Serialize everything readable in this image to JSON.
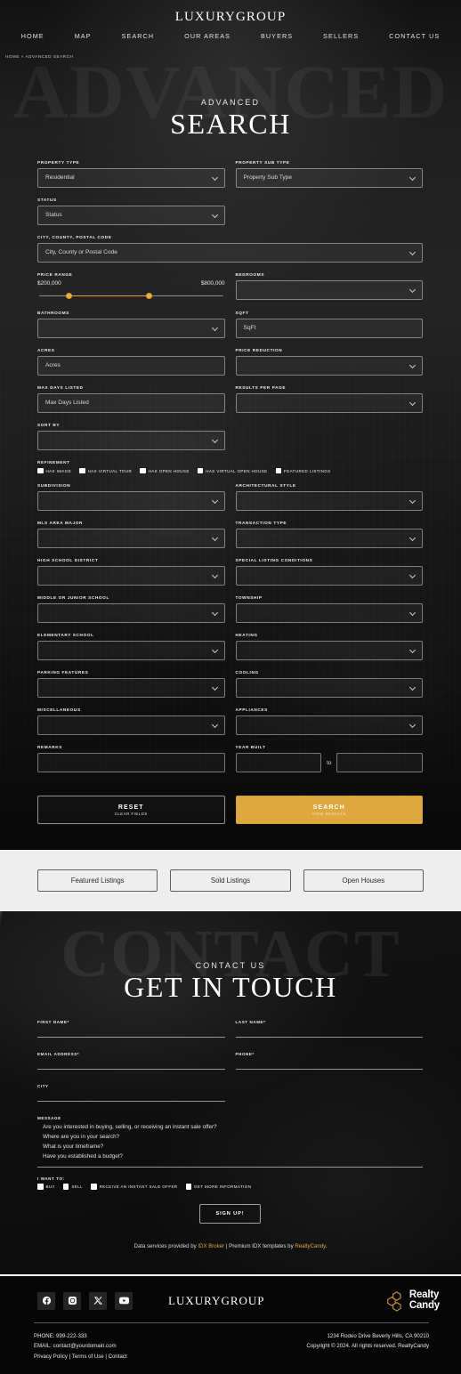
{
  "header": {
    "brand": "LUXURYGROUP",
    "nav": [
      {
        "label": "HOME"
      },
      {
        "label": "MAP"
      },
      {
        "label": "SEARCH"
      },
      {
        "label": "OUR AREAS"
      },
      {
        "label": "BUYERS"
      },
      {
        "label": "SELLERS"
      },
      {
        "label": "CONTACT US"
      }
    ],
    "breadcrumb": "HOME » ADVANCED SEARCH"
  },
  "hero": {
    "ghost_word": "ADVANCED",
    "eyebrow": "ADVANCED",
    "title": "SEARCH"
  },
  "search_form": {
    "property_type": {
      "label": "PROPERTY TYPE",
      "value": "Residential"
    },
    "property_sub_type": {
      "label": "PROPERTY SUB TYPE",
      "value": "Property Sub Type"
    },
    "status": {
      "label": "STATUS",
      "value": "Status"
    },
    "city_county_postal": {
      "label": "CITY, COUNTY, POSTAL CODE",
      "value": "City, County or Postal Code"
    },
    "price_range": {
      "label": "PRICE RANGE",
      "min": "$200,000",
      "max": "$800,000",
      "accent": "#e2a13a"
    },
    "bedrooms": {
      "label": "BEDROOMS",
      "value": ""
    },
    "bathrooms": {
      "label": "BATHROOMS",
      "value": ""
    },
    "sqft": {
      "label": "SQFT",
      "value": "SqFt"
    },
    "acres": {
      "label": "ACRES",
      "value": "Acres"
    },
    "price_reduction": {
      "label": "PRICE REDUCTION",
      "value": ""
    },
    "max_days_listed": {
      "label": "MAX DAYS LISTED",
      "value": "Max Days Listed"
    },
    "results_per_page": {
      "label": "RESULTS PER PAGE",
      "value": ""
    },
    "sort_by": {
      "label": "SORT BY",
      "value": ""
    },
    "refinement": {
      "label": "REFINEMENT",
      "options": [
        {
          "label": "HAS IMAGE",
          "checked": false
        },
        {
          "label": "HAS VIRTUAL TOUR",
          "checked": false
        },
        {
          "label": "HAS OPEN HOUSE",
          "checked": false
        },
        {
          "label": "HAS VIRTUAL OPEN HOUSE",
          "checked": false
        },
        {
          "label": "FEATURED LISTINGS",
          "checked": false
        }
      ]
    },
    "subdivision": {
      "label": "SUBDIVISION",
      "value": ""
    },
    "architectural_style": {
      "label": "ARCHITECTURAL STYLE",
      "value": ""
    },
    "mls_area_major": {
      "label": "MLS AREA MAJOR",
      "value": ""
    },
    "transaction_type": {
      "label": "TRANSACTION TYPE",
      "value": ""
    },
    "high_school_district": {
      "label": "HIGH SCHOOL DISTRICT",
      "value": ""
    },
    "special_listing_conditions": {
      "label": "SPECIAL LISTING CONDITIONS",
      "value": ""
    },
    "middle_or_junior_school": {
      "label": "MIDDLE OR JUNIOR SCHOOL",
      "value": ""
    },
    "township": {
      "label": "TOWNSHIP",
      "value": ""
    },
    "elementary_school": {
      "label": "ELEMENTARY SCHOOL",
      "value": ""
    },
    "heating": {
      "label": "HEATING",
      "value": ""
    },
    "parking_features": {
      "label": "PARKING FEATURES",
      "value": ""
    },
    "cooling": {
      "label": "COOLING",
      "value": ""
    },
    "miscellaneous": {
      "label": "MISCELLANEOUS",
      "value": ""
    },
    "appliances": {
      "label": "APPLIANCES",
      "value": ""
    },
    "remarks": {
      "label": "REMARKS",
      "value": ""
    },
    "year_built": {
      "label": "YEAR BUILT",
      "from": "",
      "separator": "to",
      "to": ""
    },
    "reset_button": {
      "title": "RESET",
      "subtitle": "CLEAR FIELDS"
    },
    "search_button": {
      "title": "SEARCH",
      "subtitle": "VIEW RESULTS",
      "color": "#dfa83e"
    }
  },
  "listing_links": [
    {
      "label": "Featured Listings"
    },
    {
      "label": "Sold Listings"
    },
    {
      "label": "Open Houses"
    }
  ],
  "contact": {
    "ghost_word": "CONTACT",
    "eyebrow": "CONTACT US",
    "title": "GET IN TOUCH",
    "fields": {
      "first_name": {
        "label": "FIRST NAME*",
        "value": ""
      },
      "last_name": {
        "label": "LAST NAME*",
        "value": ""
      },
      "email": {
        "label": "EMAIL ADDRESS*",
        "value": ""
      },
      "phone": {
        "label": "PHONE*",
        "value": ""
      },
      "city": {
        "label": "CITY",
        "value": ""
      },
      "message": {
        "label": "MESSAGE",
        "lines": [
          "Are you interested in buying, selling, or receiving an instant sale offer?",
          "Where are you in your search?",
          "What is your timeframe?",
          "Have you established a budget?"
        ]
      }
    },
    "i_want_to": {
      "label": "I WANT TO:",
      "options": [
        {
          "label": "BUY",
          "checked": false
        },
        {
          "label": "SELL",
          "checked": false
        },
        {
          "label": "RECEIVE AN INSTANT SALE OFFER",
          "checked": false
        },
        {
          "label": "GET MORE INFORMATION",
          "checked": false
        }
      ]
    },
    "signup_button": "SIGN UP!"
  },
  "data_services": {
    "prefix": "Data services provided by ",
    "idx_broker": "IDX Broker",
    "middle": " | Premium IDX templates by ",
    "realty_candy": "RealtyCandy",
    "suffix": ".",
    "link_color": "#dfa83e"
  },
  "footer": {
    "socials": [
      {
        "name": "facebook"
      },
      {
        "name": "instagram"
      },
      {
        "name": "x-twitter"
      },
      {
        "name": "youtube"
      }
    ],
    "brand": "LUXURYGROUP",
    "partner": {
      "line1": "Realty",
      "line2": "Candy"
    },
    "phone": "PHONE: 999-222-333",
    "email": "EMAIL: contact@yourdomain.com",
    "legal_links": "Privacy Policy | Terms of Use | Contact",
    "address": "1234 Rodeo Drive Beverly Hills, CA 90210",
    "copyright": "Copyright © 2024. All rights reserved. RealtyCandy"
  }
}
